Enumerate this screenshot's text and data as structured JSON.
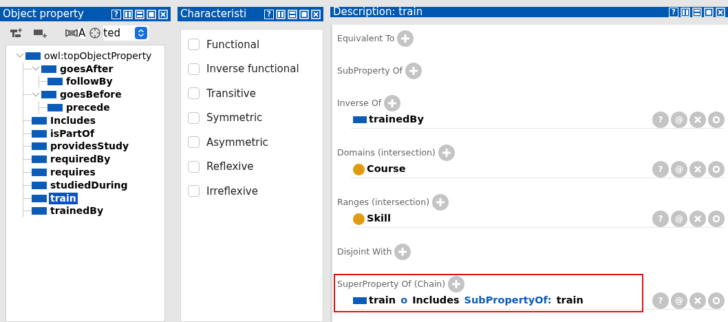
{
  "object_property_view": {
    "title": "Object property",
    "title_buttons": [
      {
        "kind": "help",
        "label": "?"
      },
      {
        "kind": "split"
      },
      {
        "kind": "minimize"
      },
      {
        "kind": "maximize"
      },
      {
        "kind": "close"
      }
    ],
    "toolbar": {
      "fragments": [
        "A",
        "ted"
      ]
    },
    "tree": [
      {
        "label": "owl:topObjectProperty",
        "bold": false,
        "selected": false,
        "expanded": true,
        "children": [
          {
            "label": "goesAfter",
            "bold": true,
            "selected": false,
            "expanded": true,
            "children": [
              {
                "label": "followBy",
                "bold": true,
                "selected": false
              }
            ]
          },
          {
            "label": "goesBefore",
            "bold": true,
            "selected": false,
            "expanded": true,
            "children": [
              {
                "label": "precede",
                "bold": true,
                "selected": false
              }
            ]
          },
          {
            "label": "Includes",
            "bold": true,
            "selected": false
          },
          {
            "label": "isPartOf",
            "bold": true,
            "selected": false
          },
          {
            "label": "providesStudy",
            "bold": true,
            "selected": false
          },
          {
            "label": "requiredBy",
            "bold": true,
            "selected": false
          },
          {
            "label": "requires",
            "bold": true,
            "selected": false
          },
          {
            "label": "studiedDuring",
            "bold": true,
            "selected": false
          },
          {
            "label": "train",
            "bold": true,
            "selected": true
          },
          {
            "label": "trainedBy",
            "bold": true,
            "selected": false
          }
        ]
      }
    ]
  },
  "characteristics_view": {
    "title": "Characteristi",
    "title_buttons": [
      {
        "kind": "help",
        "label": "?"
      },
      {
        "kind": "split"
      },
      {
        "kind": "minimize"
      },
      {
        "kind": "maximize"
      },
      {
        "kind": "close"
      }
    ],
    "items": [
      {
        "label": "Functional",
        "checked": false
      },
      {
        "label": "Inverse functional",
        "checked": false
      },
      {
        "label": "Transitive",
        "checked": false
      },
      {
        "label": "Symmetric",
        "checked": false
      },
      {
        "label": "Asymmetric",
        "checked": false
      },
      {
        "label": "Reflexive",
        "checked": false
      },
      {
        "label": "Irreflexive",
        "checked": false
      }
    ]
  },
  "description_view": {
    "title": "Description: train",
    "title_buttons": [
      {
        "kind": "help",
        "label": "?"
      },
      {
        "kind": "split"
      },
      {
        "kind": "minimize"
      },
      {
        "kind": "maximize"
      },
      {
        "kind": "close"
      }
    ],
    "sections": [
      {
        "label": "Equivalent To",
        "highlighted": false
      },
      {
        "label": "SubProperty Of",
        "highlighted": false
      },
      {
        "label": "Inverse Of",
        "highlighted": false,
        "entries": [
          {
            "kind": "property",
            "parts": [
              {
                "text": "trainedBy",
                "kind": "name"
              }
            ],
            "actions": [
              {
                "kind": "help",
                "label": "?"
              },
              {
                "kind": "annotate",
                "label": "@"
              },
              {
                "kind": "delete"
              },
              {
                "kind": "edit"
              }
            ]
          }
        ]
      },
      {
        "label": "Domains (intersection)",
        "highlighted": false,
        "entries": [
          {
            "kind": "class",
            "parts": [
              {
                "text": "Course",
                "kind": "name"
              }
            ],
            "actions": [
              {
                "kind": "help",
                "label": "?"
              },
              {
                "kind": "annotate",
                "label": "@"
              },
              {
                "kind": "delete"
              },
              {
                "kind": "edit"
              }
            ]
          }
        ]
      },
      {
        "label": "Ranges (intersection)",
        "highlighted": false,
        "entries": [
          {
            "kind": "class",
            "parts": [
              {
                "text": "Skill",
                "kind": "name"
              }
            ],
            "actions": [
              {
                "kind": "help",
                "label": "?"
              },
              {
                "kind": "annotate",
                "label": "@"
              },
              {
                "kind": "delete"
              },
              {
                "kind": "edit"
              }
            ]
          }
        ]
      },
      {
        "label": "Disjoint With",
        "highlighted": false
      },
      {
        "label": "SuperProperty Of (Chain)",
        "highlighted": true,
        "entries": [
          {
            "kind": "property",
            "parts": [
              {
                "text": "train",
                "kind": "name"
              },
              {
                "text": "o",
                "kind": "keyword"
              },
              {
                "text": "Includes",
                "kind": "name"
              },
              {
                "text": "SubPropertyOf:",
                "kind": "keyword"
              },
              {
                "text": "train",
                "kind": "name"
              }
            ],
            "actions": [
              {
                "kind": "help",
                "label": "?"
              },
              {
                "kind": "annotate",
                "label": "@"
              },
              {
                "kind": "delete"
              },
              {
                "kind": "edit"
              }
            ]
          }
        ]
      }
    ]
  }
}
